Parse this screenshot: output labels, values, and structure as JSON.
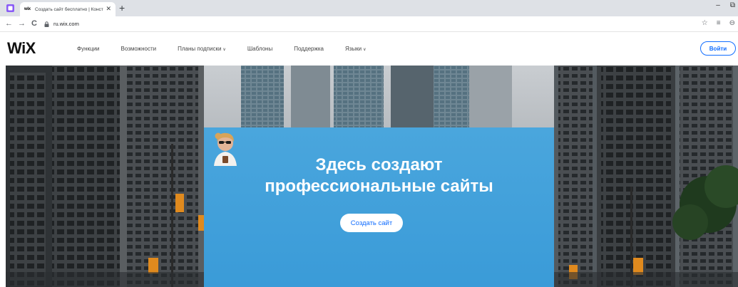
{
  "browser": {
    "tab_title": "Создать сайт бесплатно | Конст",
    "tab_favicon": "wix",
    "tab_close": "✕",
    "new_tab": "+",
    "nav_back": "←",
    "nav_forward": "→",
    "nav_reload": "C",
    "url": "ru.wix.com",
    "minimize": "–",
    "restore": "⧉",
    "star": "☆",
    "menu": "≡",
    "profile": "⊖"
  },
  "header": {
    "logo": "WiX",
    "nav": [
      {
        "label": "Функции",
        "dropdown": false
      },
      {
        "label": "Возможности",
        "dropdown": false
      },
      {
        "label": "Планы подписки",
        "dropdown": true
      },
      {
        "label": "Шаблоны",
        "dropdown": false
      },
      {
        "label": "Поддержка",
        "dropdown": false
      },
      {
        "label": "Языки",
        "dropdown": true
      }
    ],
    "login_label": "Войти"
  },
  "hero": {
    "title_line1": "Здесь создают",
    "title_line2": "профессиональные сайты",
    "cta_label": "Создать сайт"
  },
  "colors": {
    "accent": "#116dff",
    "card_blue": "#3a9bd8"
  }
}
